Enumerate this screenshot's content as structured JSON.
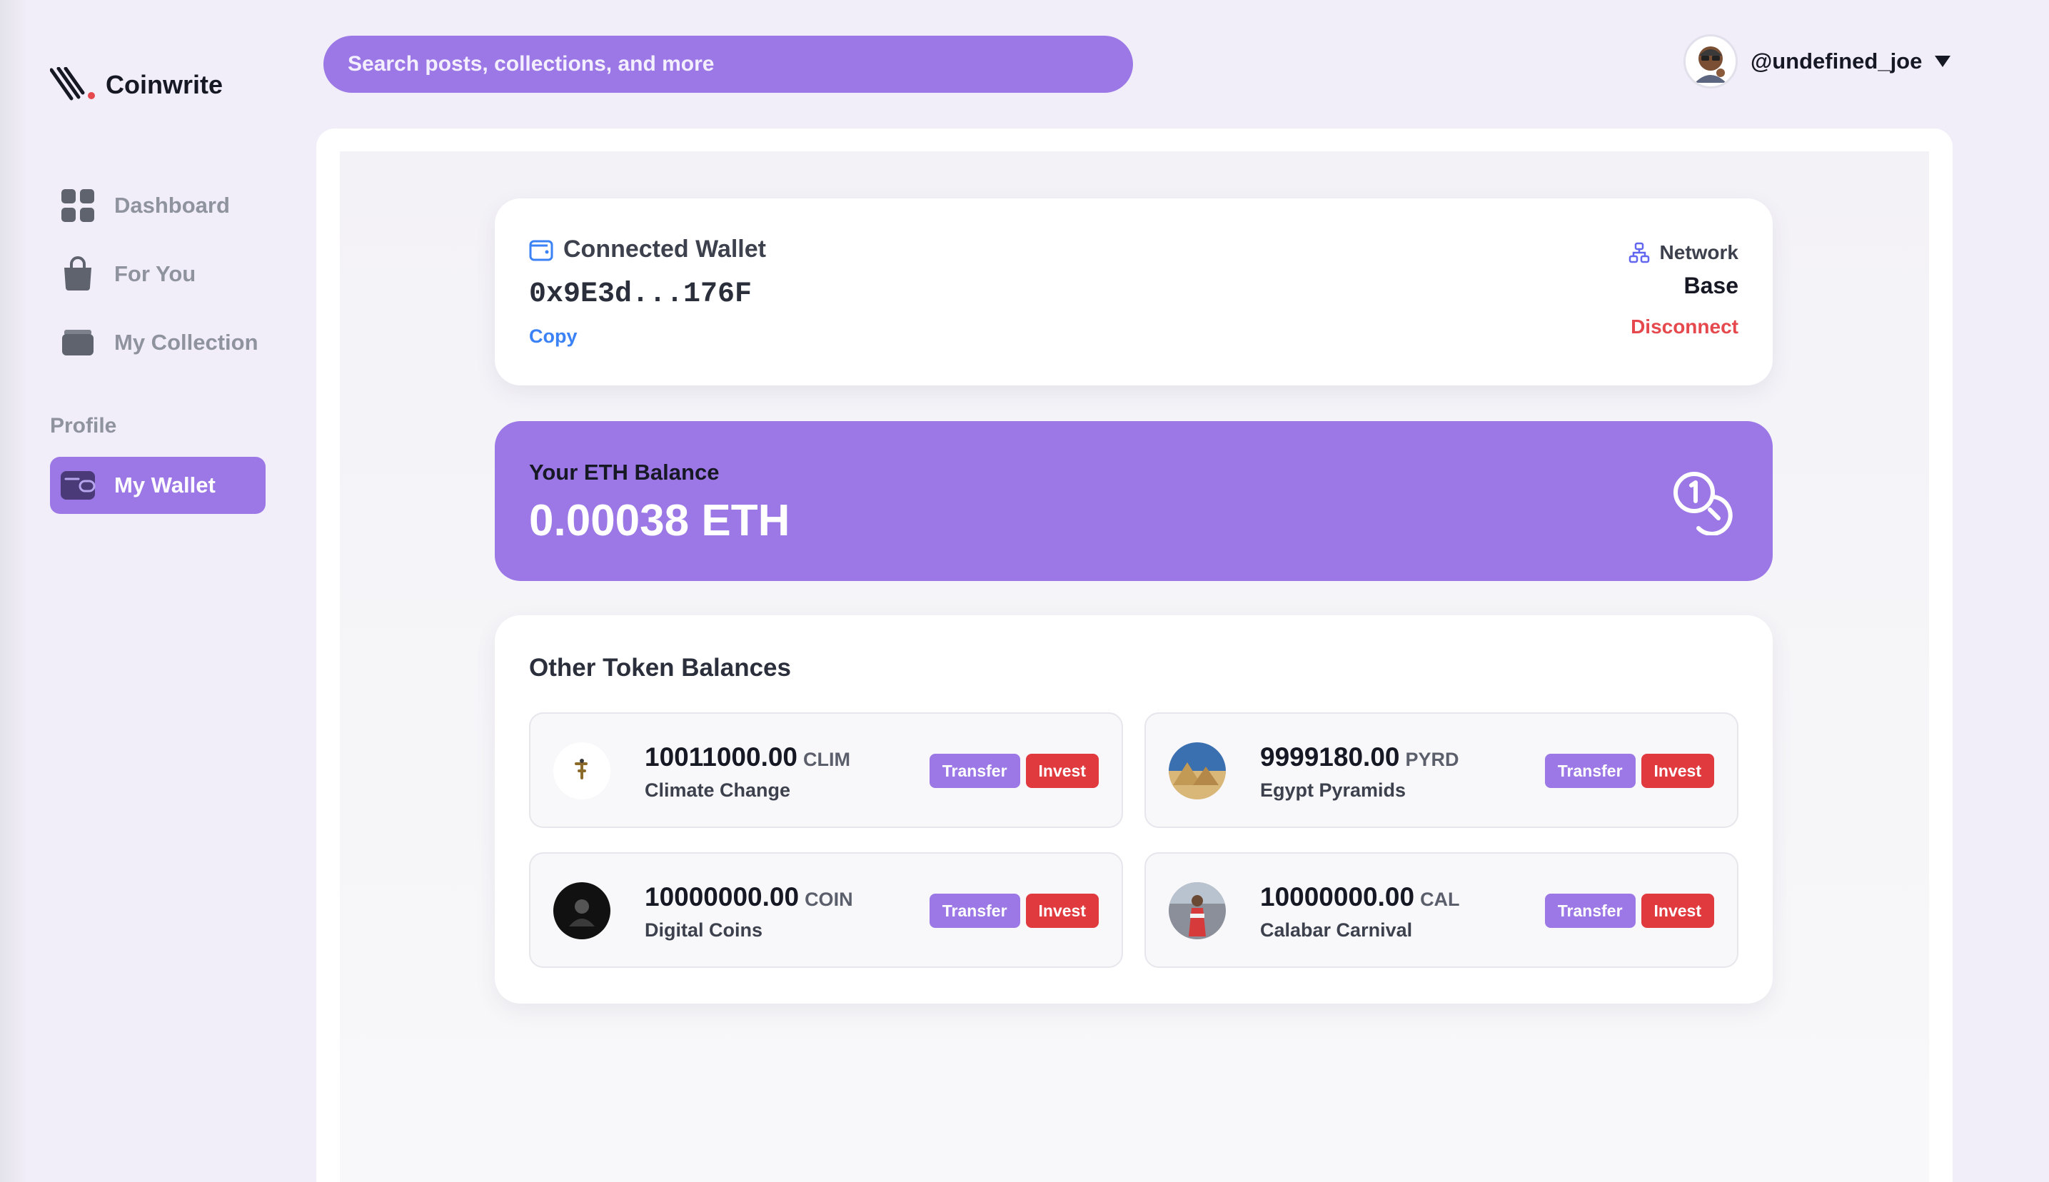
{
  "app": {
    "name": "Coinwrite"
  },
  "sidebar": {
    "items": [
      {
        "label": "Dashboard",
        "icon": "grid-icon"
      },
      {
        "label": "For You",
        "icon": "bag-icon"
      },
      {
        "label": "My Collection",
        "icon": "folder-icon"
      }
    ],
    "section_label": "Profile",
    "active_item": {
      "label": "My Wallet",
      "icon": "wallet-icon"
    }
  },
  "header": {
    "search_placeholder": "Search posts, collections, and more",
    "username": "@undefined_joe"
  },
  "wallet": {
    "title": "Connected Wallet",
    "address": "0x9E3d...176F",
    "copy_label": "Copy",
    "network_label": "Network",
    "network_value": "Base",
    "disconnect_label": "Disconnect"
  },
  "balance": {
    "label": "Your ETH Balance",
    "value": "0.00038 ETH"
  },
  "tokens": {
    "title": "Other Token Balances",
    "transfer_label": "Transfer",
    "invest_label": "Invest",
    "items": [
      {
        "amount": "10011000.00",
        "symbol": "CLIM",
        "name": "Climate Change"
      },
      {
        "amount": "9999180.00",
        "symbol": "PYRD",
        "name": "Egypt Pyramids"
      },
      {
        "amount": "10000000.00",
        "symbol": "COIN",
        "name": "Digital Coins"
      },
      {
        "amount": "10000000.00",
        "symbol": "CAL",
        "name": "Calabar Carnival"
      }
    ]
  },
  "colors": {
    "accent": "#9b78e6",
    "danger": "#e0393e",
    "link": "#3b82f6",
    "background": "#f1eef9"
  }
}
